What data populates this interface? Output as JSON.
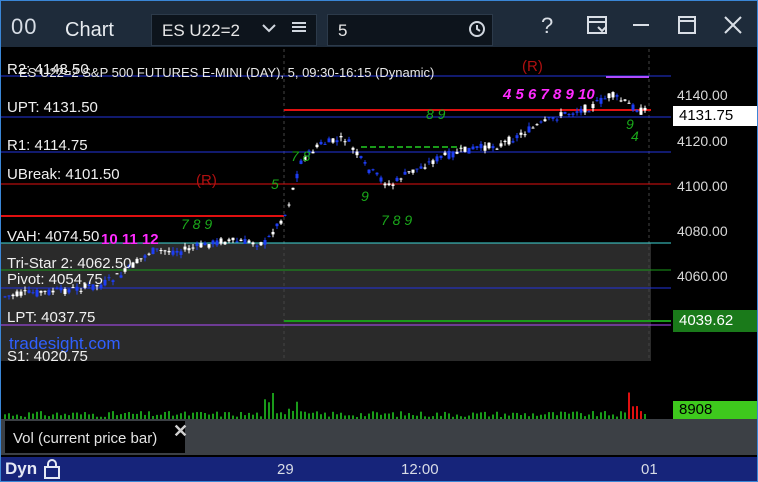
{
  "window": {
    "title": "Chart",
    "symbol": "ES U22=2",
    "interval": "5",
    "icons": [
      "chart-app-icon",
      "chevron-down-icon",
      "list-icon",
      "clock-icon",
      "help-icon",
      "template-icon",
      "minimize-icon",
      "maximize-icon",
      "close-icon"
    ]
  },
  "chart": {
    "header": "ES U22=2 S&P 500 FUTURES E-MINI (DAY), 5, 09:30-16:15 (Dynamic)",
    "watermark": "tradesight.com",
    "levels": {
      "r2": "R2: 4148.50",
      "upt": "UPT: 4131.50",
      "r1": "R1: 4114.75",
      "ubreak": "UBreak: 4101.50",
      "vah": "VAH: 4074.50",
      "tristar": "Tri-Star 2: 4062.50",
      "pivot": "Pivot: 4054.75",
      "lpt": "LPT: 4037.75",
      "s1": "S1: 4020.75"
    },
    "markers": {
      "r_mid": "(R)",
      "r_top": "(R)",
      "seq_low": "10 11 12",
      "seq_high": "4 5 6 7 8 9 10"
    },
    "colors": {
      "bull": "#ffffff",
      "bear": "#1d3df2",
      "red": "#e01010",
      "blue_line": "#2233dd",
      "cyan": "#40d8d8",
      "green": "#1a9a1a",
      "magenta": "#ff2bff",
      "purple": "#b04cff",
      "current_price_bg": "#ffffff",
      "lpt_bg": "#1a7a1a",
      "vol_bg": "#3ec91d"
    }
  },
  "axis": {
    "ticks": [
      "4140.00",
      "4120.00",
      "4100.00",
      "4080.00",
      "4060.00"
    ],
    "current_price": "4131.75",
    "lpt_price": "4039.62",
    "volume": "8908"
  },
  "volume_panel": {
    "label": "Vol (current price bar)"
  },
  "timeline": {
    "dyn": "Dyn",
    "labels": [
      "29",
      "12:00",
      "01"
    ]
  }
}
